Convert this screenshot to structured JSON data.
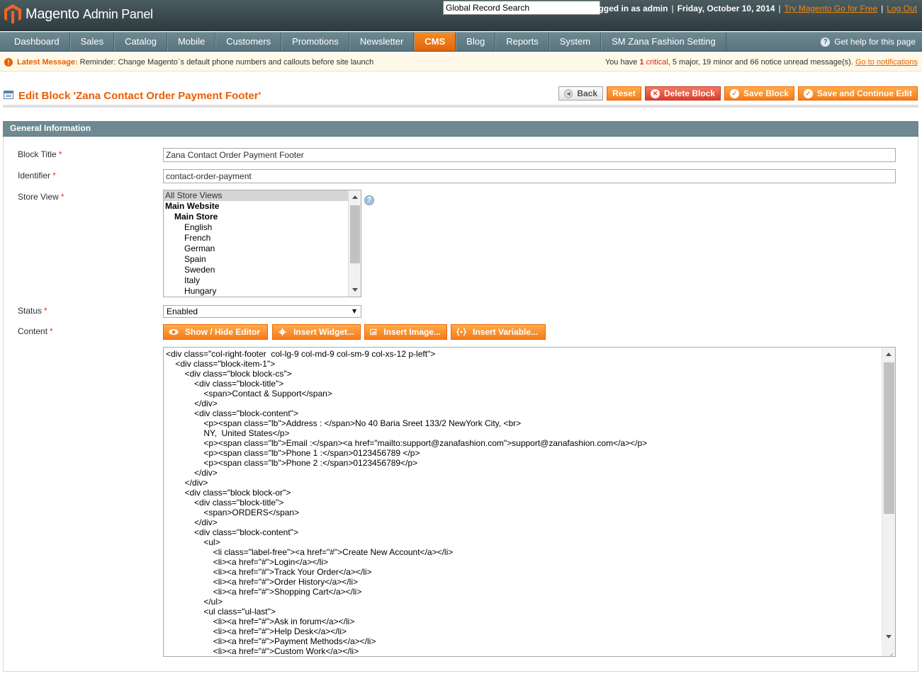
{
  "header": {
    "brand": "Magento",
    "brand_sub": "Admin Panel",
    "search_value": "Global Record Search",
    "logged_in": "Logged in as admin",
    "date": "Friday, October 10, 2014",
    "try_link": "Try Magento Go for Free",
    "logout": "Log Out"
  },
  "nav": {
    "items": [
      "Dashboard",
      "Sales",
      "Catalog",
      "Mobile",
      "Customers",
      "Promotions",
      "Newsletter",
      "CMS",
      "Blog",
      "Reports",
      "System",
      "SM Zana Fashion Setting"
    ],
    "active": "CMS",
    "help": "Get help for this page"
  },
  "message": {
    "label": "Latest Message:",
    "text": "Reminder: Change Magento`s default phone numbers and callouts before site launch",
    "summary_pre": "You have",
    "critical_count": "1",
    "critical_label": "critical",
    "major": "5 major,",
    "minor": "19 minor and",
    "notice": "66 notice unread message(s).",
    "link": "Go to notifications"
  },
  "page": {
    "title": "Edit Block 'Zana Contact Order Payment Footer'",
    "buttons": {
      "back": "Back",
      "reset": "Reset",
      "delete": "Delete Block",
      "save": "Save Block",
      "save_continue": "Save and Continue Edit"
    }
  },
  "fieldset": {
    "title": "General Information",
    "block_title_label": "Block Title",
    "block_title_value": "Zana Contact Order Payment Footer",
    "identifier_label": "Identifier",
    "identifier_value": "contact-order-payment",
    "store_view_label": "Store View",
    "store_options": [
      "All Store Views",
      "Main Website",
      "Main Store",
      "English",
      "French",
      "German",
      "Spain",
      "Sweden",
      "Italy",
      "Hungary"
    ],
    "status_label": "Status",
    "status_value": "Enabled",
    "content_label": "Content",
    "editor_buttons": {
      "show_hide": "Show / Hide Editor",
      "widget": "Insert Widget...",
      "image": "Insert Image...",
      "variable": "Insert Variable..."
    },
    "content_value": "<div class=\"col-right-footer  col-lg-9 col-md-9 col-sm-9 col-xs-12 p-left\">\n\t<div class=\"block-item-1\">\n\t\t<div class=\"block block-cs\">\n\t\t\t<div class=\"block-title\">\n\t\t\t\t<span>Contact & Support</span>\n\t\t\t</div>\n\t\t\t<div class=\"block-content\">\n\t\t\t\t<p><span class=\"lb\">Address : </span>No 40 Baria Sreet 133/2 NewYork City, <br>\n\t\t\t\tNY,  United States</p>\n\t\t\t\t<p><span class=\"lb\">Email :</span><a href=\"mailto:support@zanafashion.com\">support@zanafashion.com</a></p>\n\t\t\t\t<p><span class=\"lb\">Phone 1 :</span>0123456789 </p>\n\t\t\t\t<p><span class=\"lb\">Phone 2 :</span>0123456789</p>\n\t\t\t</div>\n\t\t</div>\n\t\t<div class=\"block block-or\">\n\t\t\t<div class=\"block-title\">\n\t\t\t\t<span>ORDERS</span>\n\t\t\t</div>\n\t\t\t<div class=\"block-content\">\n\t\t\t\t<ul>\n\t\t\t\t\t<li class=\"label-free\"><a href=\"#\">Create New Account</a></li>\n\t\t\t\t\t<li><a href=\"#\">Login</a></li>\n\t\t\t\t\t<li><a href=\"#\">Track Your Order</a></li>\n\t\t\t\t\t<li><a href=\"#\">Order History</a></li>\n\t\t\t\t\t<li><a href=\"#\">Shopping Cart</a></li>\n\t\t\t\t</ul>\n\t\t\t\t<ul class=\"ul-last\">\n\t\t\t\t\t<li><a href=\"#\">Ask in forum</a></li>\n\t\t\t\t\t<li><a href=\"#\">Help Desk</a></li>\n\t\t\t\t\t<li><a href=\"#\">Payment Methods</a></li>\n\t\t\t\t\t<li><a href=\"#\">Custom Work</a></li>"
  },
  "colors": {
    "accent": "#eb5e00",
    "header_bg": "#3a4a4f",
    "nav_bg": "#627e87",
    "button_orange": "#f47a1d",
    "button_red": "#d93e2d"
  }
}
